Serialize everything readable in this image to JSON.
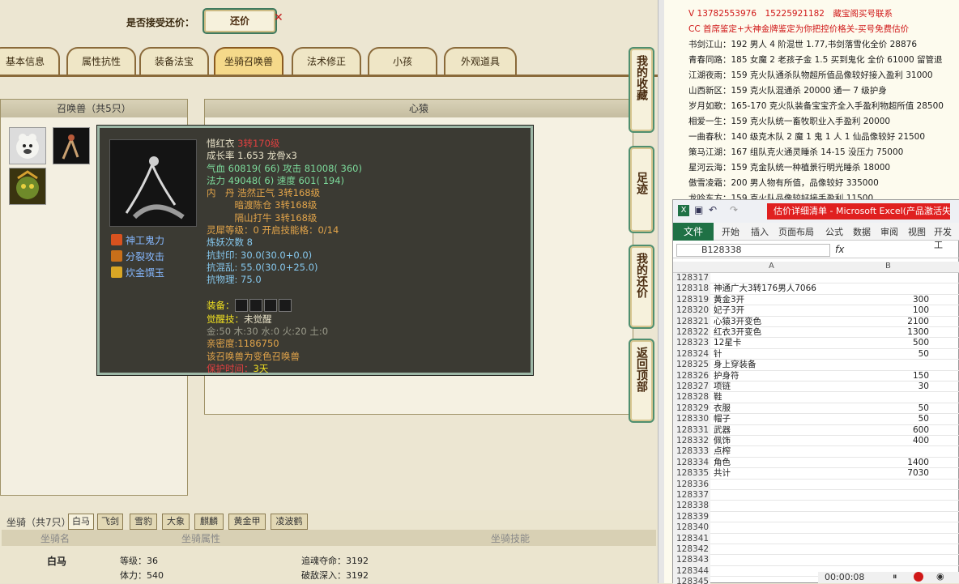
{
  "offer": {
    "label": "是否接受还价：",
    "button": "还价"
  },
  "tabs": [
    "基本信息",
    "属性抗性",
    "装备法宝",
    "坐骑召唤兽",
    "法术修正",
    "小孩",
    "外观道具"
  ],
  "summon_header": "召唤兽（共5只）",
  "rec_header": "心猿",
  "tooltip": {
    "name": "惜红衣",
    "name_level": "3转170级",
    "lines": [
      {
        "t": "成长率 1.653 龙骨x3",
        "c": "c-w"
      },
      {
        "t": "气血 60819( 66) 攻击 81008( 360)",
        "c": "c-g"
      },
      {
        "t": "法力 49048( 6) 速度 601( 194)",
        "c": "c-g"
      },
      {
        "t": "内　丹 浩然正气 3转168级",
        "c": "c-o"
      },
      {
        "t": "　　　暗渡陈仓 3转168级",
        "c": "c-o"
      },
      {
        "t": "　　　隔山打牛 3转168级",
        "c": "c-o"
      },
      {
        "t": "灵犀等级：0 开启技能格：0/14",
        "c": "c-o"
      },
      {
        "t": "炼妖次数 8",
        "c": "c-b"
      },
      {
        "t": "抗封印: 30.0(30.0+0.0)",
        "c": "c-b"
      },
      {
        "t": "抗混乱: 55.0(30.0+25.0)",
        "c": "c-b"
      },
      {
        "t": "抗物理: 75.0",
        "c": "c-b"
      }
    ],
    "equip_label": "装备：",
    "awaken_label": "觉醒技：",
    "awaken_value": "未觉醒",
    "elements": "金:50 木:30 水:0 火:20 土:0",
    "intimacy": "亲密度:1186750",
    "variant": "该召唤兽为变色召唤兽",
    "protect_label": "保护时间：",
    "protect_value": "3天",
    "skills": [
      "神工鬼力",
      "分裂攻击",
      "炊金馔玉"
    ]
  },
  "side_buttons": [
    "我的收藏",
    "足迹",
    "我的还价",
    "返回顶部"
  ],
  "mount": {
    "title": "坐骑（共7只）",
    "tabs": [
      "白马",
      "飞剑",
      "雪豹",
      "大象",
      "麒麟",
      "黄金甲",
      "凌波鹤"
    ],
    "col_name": "坐骑名",
    "col_attr": "坐骑属性",
    "col_skill": "坐骑技能",
    "row_name": "白马",
    "row_level": "等级：36",
    "row_vitality": "体力：540",
    "row_skill1": "追魂夺命：3192",
    "row_skill2": "破敌深入：3192"
  },
  "stream": [
    {
      "t": "V 13782553976　15225921182　藏宝阁买号联系",
      "c": "#d01818"
    },
    {
      "t": "CC 首席鉴定+大神金牌鉴定为你把控价格关-买号免费估价",
      "c": "#d01818"
    },
    {
      "t": "书剑江山：192 男人 4 阶混世 1.77,书剑落雪化全价 28876",
      "c": "#1a1a1a"
    },
    {
      "t": "青春同路：185 女魔 2 老孩子金 1.5 买到鬼化 全价 61000 留管退",
      "c": "#1a1a1a"
    },
    {
      "t": "江湖夜雨：159 克火队通杀队物超所值品像较好接入盈利 31000",
      "c": "#1a1a1a"
    },
    {
      "t": "山西新区：159 克火队混通杀 20000 通一 7 级护身",
      "c": "#1a1a1a"
    },
    {
      "t": "岁月如歌：165-170 克火队装备宝宝齐全入手盈利物超所值 28500",
      "c": "#1a1a1a"
    },
    {
      "t": "相爱一生：159 克火队统一畜牧职业入手盈利 20000",
      "c": "#1a1a1a"
    },
    {
      "t": "一曲春秋：140 级克木队 2 魔 1 鬼 1 人 1 仙品像较好 21500",
      "c": "#1a1a1a"
    },
    {
      "t": "策马江湖：167 组队克火通灵睡杀 14-15 没压力 75000",
      "c": "#1a1a1a"
    },
    {
      "t": "星河云海：159 克金队统一种植景行明光睡杀 18000",
      "c": "#1a1a1a"
    },
    {
      "t": "傲雪凌霜：200 男人物有所值，品像较好 335000",
      "c": "#1a1a1a"
    },
    {
      "t": "龙吟东方：159 克火队品像较好接手盈利 11500",
      "c": "#1a1a1a"
    }
  ],
  "excel": {
    "title_red": "估价详细清单 - Microsoft Excel(产品激活失败)",
    "file_tab": "文件",
    "ribbon": [
      "开始",
      "插入",
      "页面布局",
      "公式",
      "数据",
      "审阅",
      "视图",
      "开发工"
    ],
    "name_box": "B128338",
    "fx": "fx",
    "col_a": "A",
    "col_b": "B",
    "rows": [
      [
        "128317",
        "",
        ""
      ],
      [
        "128318",
        "神通广大3转176男人7066",
        ""
      ],
      [
        "128319",
        "黄金3开",
        "300"
      ],
      [
        "128320",
        "妃子3开",
        "100"
      ],
      [
        "128321",
        "心猿3开变色",
        "2100"
      ],
      [
        "128322",
        "红衣3开变色",
        "1300"
      ],
      [
        "128323",
        "12星卡",
        "500"
      ],
      [
        "128324",
        "针",
        "50"
      ],
      [
        "128325",
        "身上穿装备",
        ""
      ],
      [
        "128326",
        "护身符",
        "150"
      ],
      [
        "128327",
        "项链",
        "30"
      ],
      [
        "128328",
        "鞋",
        ""
      ],
      [
        "128329",
        "衣服",
        "50"
      ],
      [
        "128330",
        "帽子",
        "50"
      ],
      [
        "128331",
        "武器",
        "600"
      ],
      [
        "128332",
        "佩饰",
        "400"
      ],
      [
        "128333",
        "点榨",
        ""
      ],
      [
        "128334",
        "角色",
        "1400"
      ],
      [
        "128335",
        "共计",
        "7030"
      ],
      [
        "128336",
        "",
        ""
      ],
      [
        "128337",
        "",
        ""
      ],
      [
        "128338",
        "",
        ""
      ],
      [
        "128339",
        "",
        ""
      ],
      [
        "128340",
        "",
        ""
      ],
      [
        "128341",
        "",
        ""
      ],
      [
        "128342",
        "",
        ""
      ],
      [
        "128343",
        "",
        ""
      ],
      [
        "128344",
        "",
        ""
      ],
      [
        "128345",
        "",
        ""
      ]
    ]
  },
  "recorder": {
    "time": "00:00:08"
  }
}
